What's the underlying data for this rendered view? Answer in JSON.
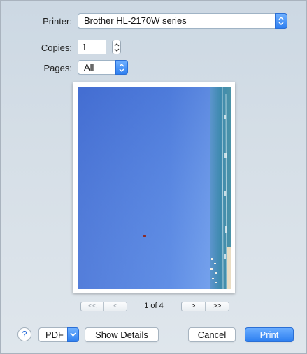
{
  "printer": {
    "label": "Printer:",
    "value": "Brother HL-2170W series"
  },
  "copies": {
    "label": "Copies:",
    "value": "1"
  },
  "pages": {
    "label": "Pages:",
    "value": "All"
  },
  "preview": {
    "page_indicator": "1 of 4"
  },
  "navigation": {
    "first": "<<",
    "previous": "<",
    "next": ">",
    "last": ">>"
  },
  "footer": {
    "help_label": "?",
    "pdf_label": "PDF",
    "show_details_label": "Show Details",
    "cancel_label": "Cancel",
    "print_label": "Print"
  },
  "colors": {
    "accent": "#2f80f0",
    "dialog_background": "#d6dfe7",
    "sky_top": "#4a73d6",
    "sky_bottom": "#6c9cec",
    "sea": "#3f8fb4"
  }
}
